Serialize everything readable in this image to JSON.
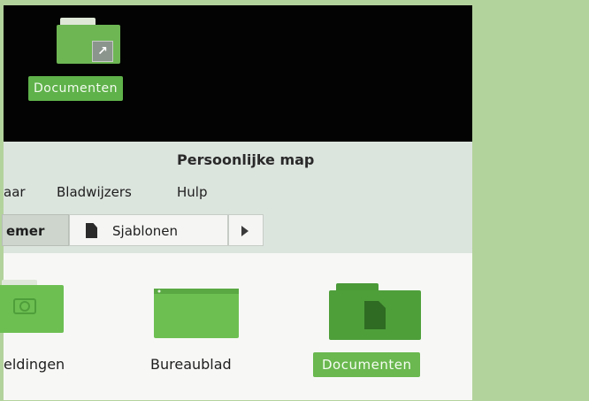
{
  "desktop": {
    "icons": [
      {
        "label": "Documenten"
      }
    ]
  },
  "window": {
    "title": "Persoonlijke map",
    "menu": {
      "items": [
        {
          "label": "aar"
        },
        {
          "label": "Bladwijzers"
        },
        {
          "label": "Hulp"
        }
      ]
    },
    "pathbar": {
      "buttons": [
        {
          "label": "emer",
          "active": true
        },
        {
          "label": "Sjablonen",
          "icon": "document-icon"
        }
      ],
      "next": "arrow-right-icon"
    },
    "files": [
      {
        "label": "eldingen",
        "icon": "camera-folder-icon"
      },
      {
        "label": "Bureaublad",
        "icon": "desktop-folder-icon"
      },
      {
        "label": "Documenten",
        "icon": "document-folder-icon",
        "selected": true
      }
    ]
  },
  "colors": {
    "accent": "#6ab84f",
    "desktop_background": "#030303",
    "side_panel": "#b3d39c",
    "window_chrome": "#dce4de"
  }
}
